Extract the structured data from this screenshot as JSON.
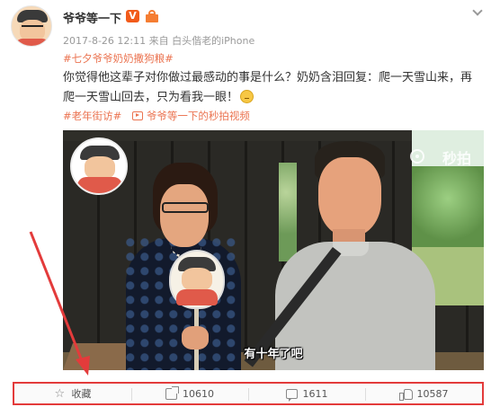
{
  "post": {
    "author": "爷爷等一下",
    "verified_badge": "V",
    "meta": "2017-8-26 12:11 来自 白头偕老的iPhone",
    "topic_tag": "#七夕爷爷奶奶撒狗粮#",
    "text": "你觉得他这辈子对你做过最感动的事是什么？奶奶含泪回复：爬一天雪山来，再爬一天雪山回去，只为看我一眼！",
    "emoji_icon": "sad-face-emoji",
    "footer_tag": "#老年街访#",
    "video_link": "爷爷等一下的秒拍视频"
  },
  "video": {
    "brand": "秒拍",
    "subtitle": "有十年了吧"
  },
  "actions": {
    "favorite_label": "收藏",
    "repost_count": "10610",
    "comment_count": "1611",
    "like_count": "10587"
  },
  "colors": {
    "accent": "#eb7350",
    "highlight_box": "#e33b3b",
    "verified": "#f25b1a"
  }
}
